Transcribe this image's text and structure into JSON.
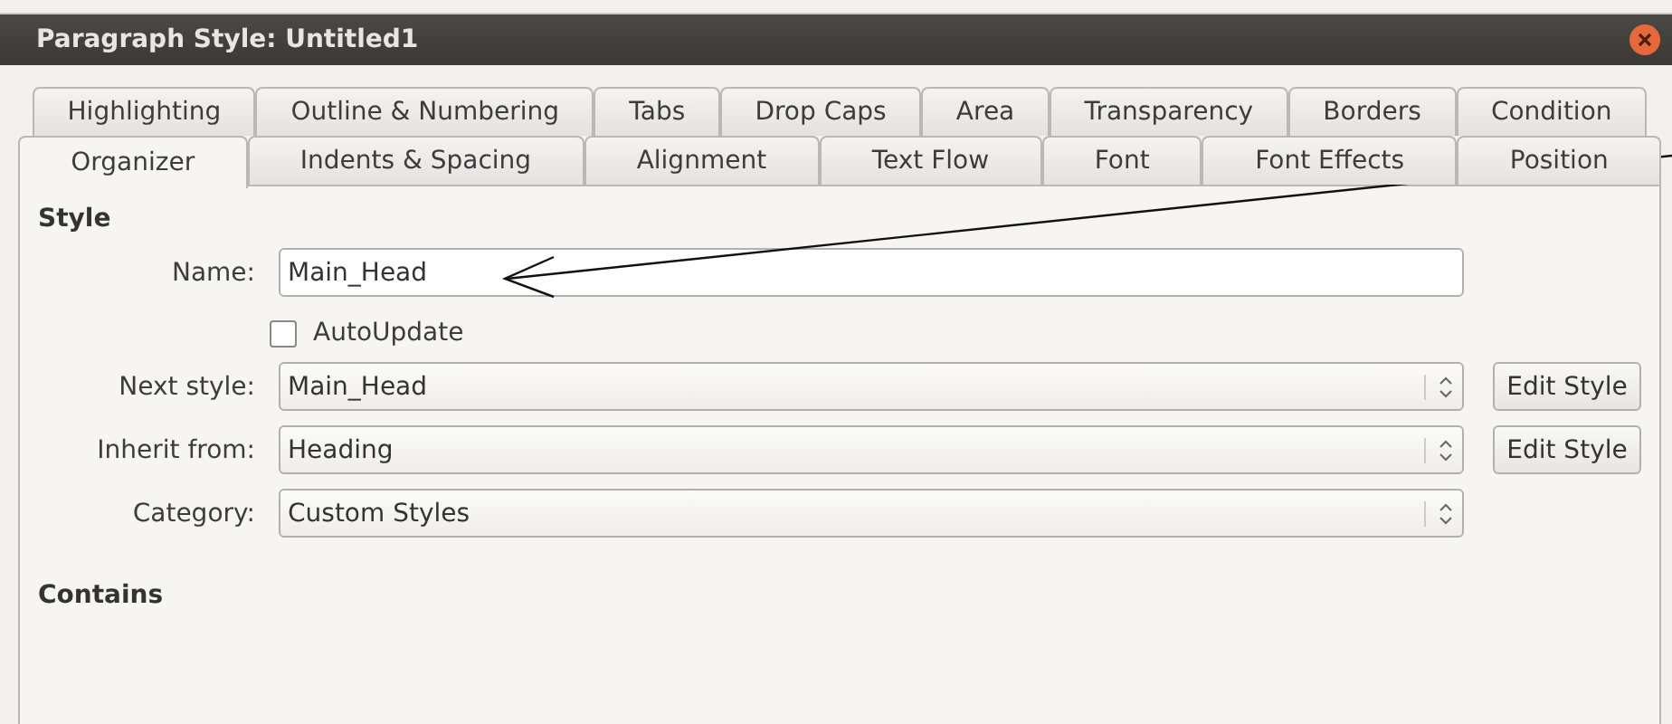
{
  "window": {
    "title": "Paragraph Style: Untitled1"
  },
  "tab_rows": [
    [
      {
        "label": "Highlighting",
        "selected": false
      },
      {
        "label": "Outline & Numbering",
        "selected": false
      },
      {
        "label": "Tabs",
        "selected": false
      },
      {
        "label": "Drop Caps",
        "selected": false
      },
      {
        "label": "Area",
        "selected": false
      },
      {
        "label": "Transparency",
        "selected": false
      },
      {
        "label": "Borders",
        "selected": false
      },
      {
        "label": "Condition",
        "selected": false
      }
    ],
    [
      {
        "label": "Organizer",
        "selected": true
      },
      {
        "label": "Indents & Spacing",
        "selected": false
      },
      {
        "label": "Alignment",
        "selected": false
      },
      {
        "label": "Text Flow",
        "selected": false
      },
      {
        "label": "Font",
        "selected": false
      },
      {
        "label": "Font Effects",
        "selected": false
      },
      {
        "label": "Position",
        "selected": false
      }
    ]
  ],
  "style_section": {
    "heading": "Style",
    "fields": [
      {
        "kind": "text",
        "label": "Name:",
        "value": "Main_Head"
      },
      {
        "kind": "checkbox",
        "label": "AutoUpdate",
        "checked": false
      },
      {
        "kind": "dropdown",
        "label": "Next style:",
        "value": "Main_Head",
        "button": "Edit Style"
      },
      {
        "kind": "dropdown",
        "label": "Inherit from:",
        "value": "Heading",
        "button": "Edit Style"
      },
      {
        "kind": "dropdown",
        "label": "Category:",
        "value": "Custom Styles"
      }
    ]
  },
  "contains_section": {
    "heading": "Contains"
  }
}
